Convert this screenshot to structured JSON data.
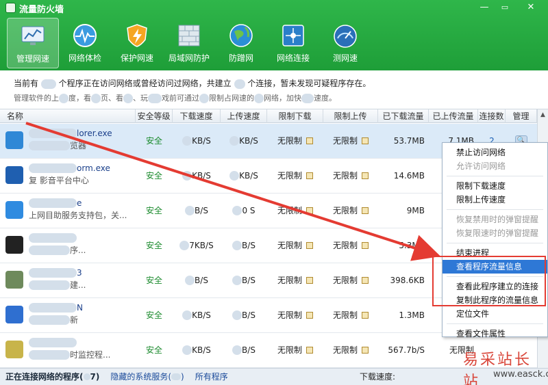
{
  "window": {
    "title": "流量防火墙",
    "minimize": "—",
    "close": "✕"
  },
  "toolbar": [
    {
      "label": "管理网速",
      "icon": "monitor-chart-icon",
      "active": true
    },
    {
      "label": "网络体检",
      "icon": "heartbeat-icon",
      "active": false
    },
    {
      "label": "保护网速",
      "icon": "lightning-shield-icon",
      "active": false
    },
    {
      "label": "局域网防护",
      "icon": "firewall-wall-icon",
      "active": false
    },
    {
      "label": "防蹭网",
      "icon": "globe-icon",
      "active": false
    },
    {
      "label": "网络连接",
      "icon": "network-connection-icon",
      "active": false
    },
    {
      "label": "测网速",
      "icon": "speedometer-icon",
      "active": false
    }
  ],
  "info": {
    "line1_a": "当前有",
    "line1_b": "个程序正在访问网络或曾经访问过网络，共建立",
    "line1_c": "个连接，暂未发现可疑程序存在。",
    "line2_a": "管理软件的上",
    "line2_b": "度，看",
    "line2_c": "页、看",
    "line2_d": "、玩",
    "line2_e": "戏前可通过",
    "line2_f": "限制占网速的",
    "line2_g": "网络，加快",
    "line2_h": "速度。"
  },
  "table": {
    "columns": [
      "名称",
      "安全等级",
      "下载速度",
      "上传速度",
      "限制下载",
      "限制上传",
      "已下载流量",
      "已上传流量",
      "连接数",
      "管理"
    ],
    "rows": [
      {
        "name": "lorer.exe",
        "desc": "览器",
        "security": "安全",
        "dl": "KB/S",
        "ul": "KB/S",
        "limit_dl": "无限制",
        "limit_ul": "无限制",
        "total_dl": "53.7MB",
        "total_ul": "7.1MB",
        "conn": "2",
        "icon_color": "#2f88d6",
        "selected": true
      },
      {
        "name": "orm.exe",
        "desc": "复   影音平台中心",
        "security": "安全",
        "dl": "KB/S",
        "ul": "KB/S",
        "limit_dl": "无限制",
        "limit_ul": "无限制",
        "total_dl": "14.6MB",
        "total_ul": "",
        "conn": "",
        "icon_color": "#1f5fb0",
        "selected": false
      },
      {
        "name": "e",
        "desc": "上网目助服务支持包，关...",
        "security": "安全",
        "dl": "B/S",
        "ul": "0   S",
        "limit_dl": "无限制",
        "limit_ul": "无限制",
        "total_dl": "9MB",
        "total_ul": "",
        "conn": "",
        "icon_color": "#2f8be0",
        "selected": false
      },
      {
        "name": "",
        "desc": "序...",
        "security": "安全",
        "dl": "7KB/S",
        "ul": "B/S",
        "limit_dl": "无限制",
        "limit_ul": "无限制",
        "total_dl": "5.3MB",
        "total_ul": "",
        "conn": "",
        "icon_color": "#222222",
        "selected": false
      },
      {
        "name": "3",
        "desc": "建...",
        "security": "安全",
        "dl": "B/S",
        "ul": "B/S",
        "limit_dl": "无限制",
        "limit_ul": "无限制",
        "total_dl": "398.6KB",
        "total_ul": "",
        "conn": "",
        "icon_color": "#6e8a5c",
        "selected": false
      },
      {
        "name": "N",
        "desc": "新",
        "security": "安全",
        "dl": "KB/S",
        "ul": "B/S",
        "limit_dl": "无限制",
        "limit_ul": "无限制",
        "total_dl": "1.3MB",
        "total_ul": "",
        "conn": "",
        "icon_color": "#2f6fd0",
        "selected": false
      },
      {
        "name": "",
        "desc": "时监控程...",
        "security": "安全",
        "dl": "KB/S",
        "ul": "B/S",
        "limit_dl": "无限制",
        "limit_ul": "无限制",
        "total_dl": "567.7b/S",
        "total_ul": "无限制",
        "conn": "",
        "icon_color": "#c8b44a",
        "selected": false
      }
    ]
  },
  "context_menu": {
    "items": [
      {
        "label": "禁止访问网络",
        "disabled": false
      },
      {
        "label": "允许访问网络",
        "disabled": true
      },
      {
        "sep": true
      },
      {
        "label": "限制下载速度",
        "disabled": false
      },
      {
        "label": "限制上传速度",
        "disabled": false
      },
      {
        "sep": true
      },
      {
        "label": "恢复禁用时的弹窗提醒",
        "disabled": true
      },
      {
        "label": "恢复限速时的弹窗提醒",
        "disabled": true
      },
      {
        "sep": true
      },
      {
        "label": "结束进程",
        "disabled": false
      },
      {
        "label": "查看程序流量信息",
        "disabled": false,
        "highlight": true
      },
      {
        "sep": true
      },
      {
        "label": "查看此程序建立的连接",
        "disabled": false
      },
      {
        "label": "复制此程序的流量信息",
        "disabled": false
      },
      {
        "label": "定位文件",
        "disabled": false
      },
      {
        "sep": true
      },
      {
        "label": "查看文件属性",
        "disabled": false
      }
    ]
  },
  "footer": {
    "tab1": "正在连接网络的程序(",
    "tab1_suffix": "7)",
    "tab2": "隐藏的系统服务(",
    "tab2_suffix": ")",
    "tab3": "所有程序",
    "download_speed_label": "下载速度:"
  },
  "watermark": {
    "text": "易采站长站",
    "url": "www.easck.com"
  },
  "colors": {
    "brand_green": "#22a83d",
    "highlight_blue": "#2e78d6",
    "annotation_red": "#e43b32"
  }
}
